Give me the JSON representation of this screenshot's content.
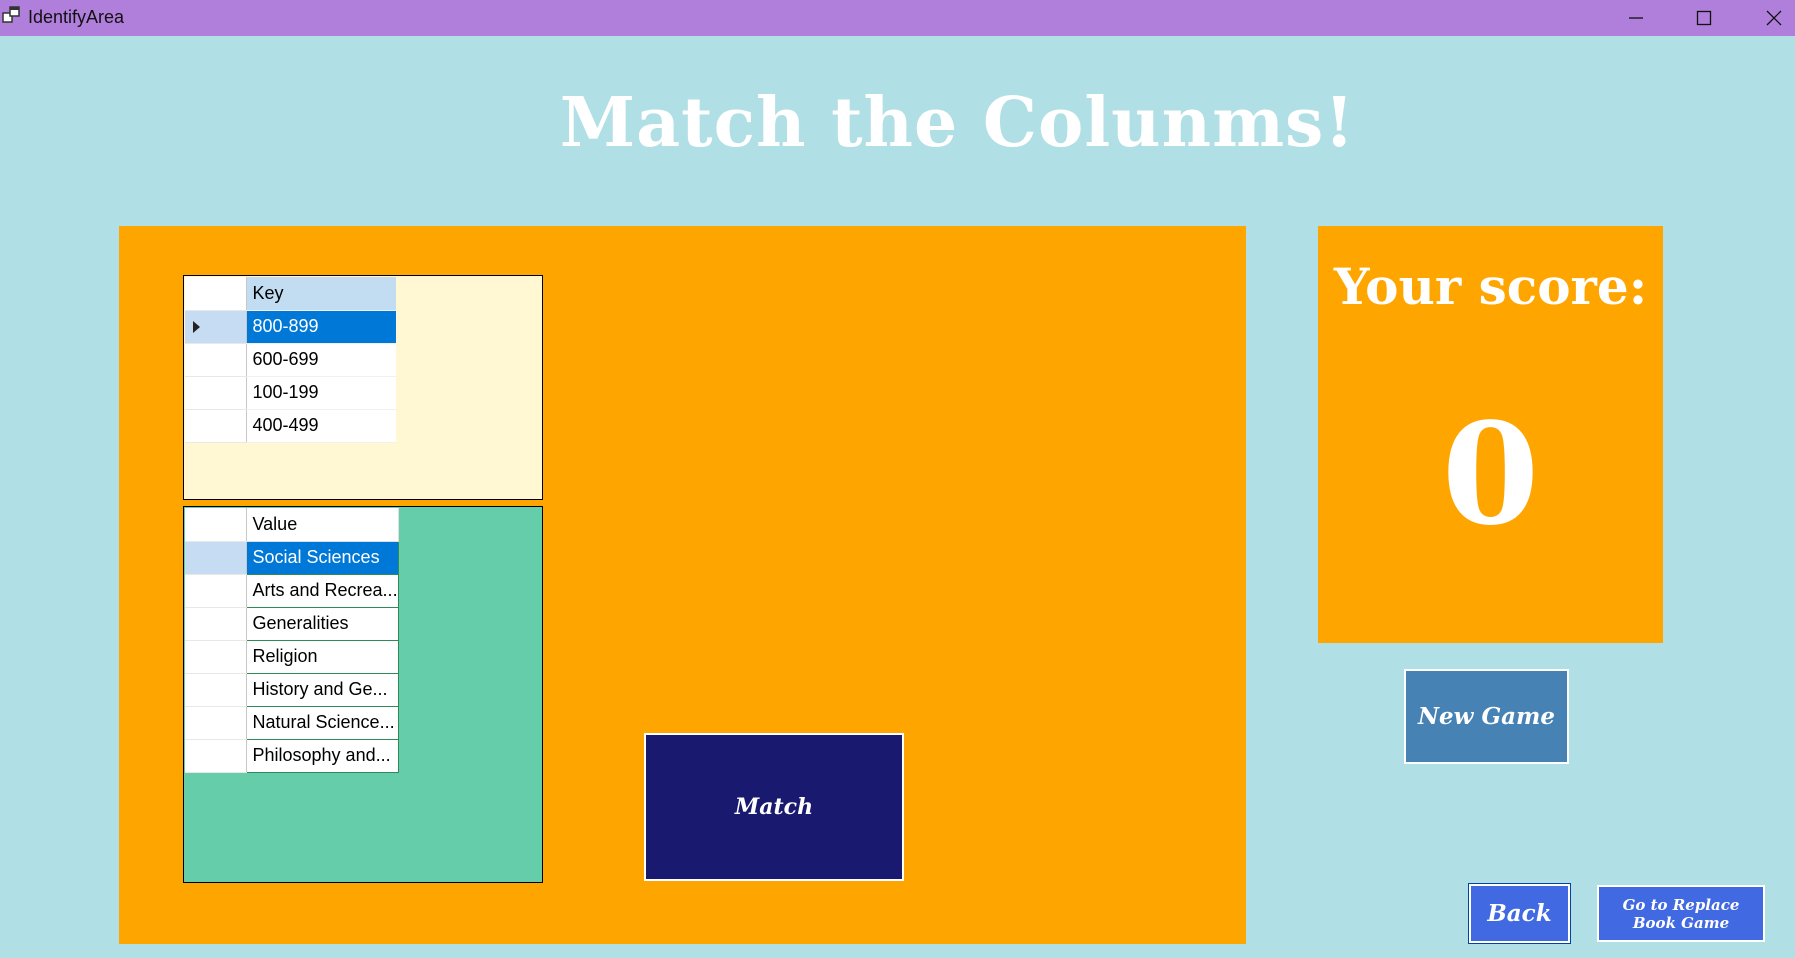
{
  "window": {
    "title": "IdentifyArea"
  },
  "heading": "Match the Colunms!",
  "key_grid": {
    "column_header": "Key",
    "selected_index": 0,
    "rows": [
      "800-899",
      "600-699",
      "100-199",
      "400-499"
    ]
  },
  "value_grid": {
    "column_header": "Value",
    "selected_index": 0,
    "rows": [
      "Social Sciences",
      "Arts and Recrea...",
      "Generalities",
      "Religion",
      "History and Ge...",
      "Natural Science...",
      "Philosophy and..."
    ]
  },
  "buttons": {
    "match": "Match",
    "new_game": "New Game",
    "back": "Back",
    "replace_game": "Go to Replace Book Game"
  },
  "score": {
    "label": "Your score:",
    "value": "0"
  },
  "colors": {
    "background": "#b0dfe5",
    "titlebar": "#b07fdb",
    "panel": "#ffa500",
    "match_button": "#191970",
    "new_game_button": "#4682b4",
    "nav_button": "#4169e1",
    "selection": "#0078d7"
  }
}
